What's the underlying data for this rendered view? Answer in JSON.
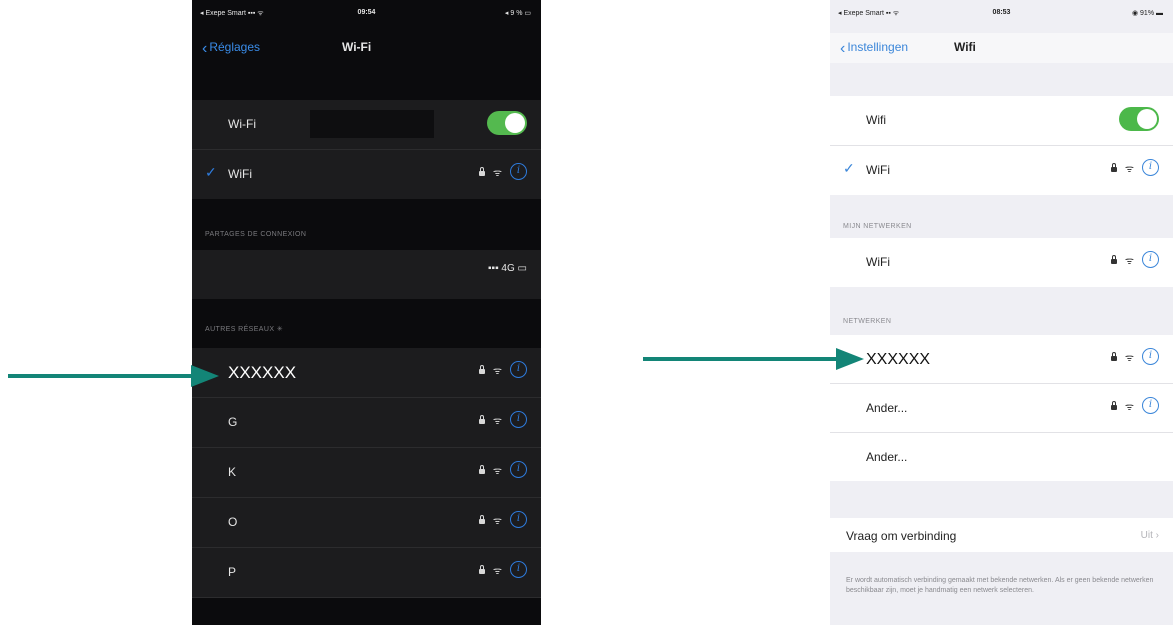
{
  "arrow_color": "#138577",
  "left_phone": {
    "status": {
      "carrier": "◂ Exepe Smart ▪▪▪ ᯤ",
      "time": "09:54",
      "battery": "◂ 9 % ▭"
    },
    "nav": {
      "back": "Réglages",
      "title": "Wi-Fi"
    },
    "toggle_row": {
      "label": "Wi-Fi",
      "on": true
    },
    "connected": {
      "label": "WiFi"
    },
    "hotspot_header": "PARTAGES DE CONNEXION",
    "hotspot_row": {
      "status": "▪▪▪ 4G ▭"
    },
    "other_header": "AUTRES RÉSEAUX",
    "networks": [
      {
        "name": "XXXXXX"
      },
      {
        "name": "G"
      },
      {
        "name": "K"
      },
      {
        "name": "O"
      },
      {
        "name": "P"
      }
    ]
  },
  "right_phone": {
    "status": {
      "carrier": "◂ Exepe Smart ▪▪ ᯤ",
      "time": "08:53",
      "battery": "◉ 91% ▬"
    },
    "nav": {
      "back": "Instellingen",
      "title": "Wifi"
    },
    "toggle_row": {
      "label": "Wifi",
      "on": true
    },
    "connected": {
      "label": "WiFi"
    },
    "my_networks_header": "MIJN NETWERKEN",
    "my_networks": [
      {
        "name": "WiFi"
      }
    ],
    "networks_header": "NETWERKEN",
    "networks": [
      {
        "name": "XXXXXX"
      },
      {
        "name": "Ander..."
      },
      {
        "name": "Ander..."
      }
    ],
    "ask_to_join": {
      "label": "Vraag om verbinding",
      "value": "Uit"
    },
    "ask_to_join_note": "Er wordt automatisch verbinding gemaakt met bekende netwerken. Als er geen bekende netwerken beschikbaar zijn, moet je handmatig een netwerk selecteren."
  }
}
